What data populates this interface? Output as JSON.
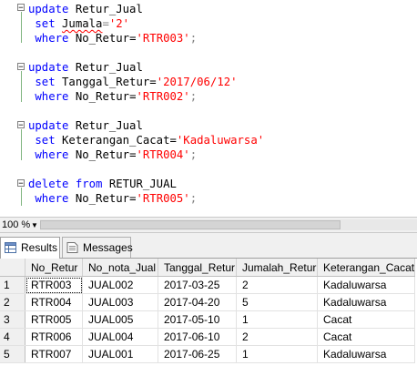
{
  "editor": {
    "blocks": [
      {
        "l1_kw": "update",
        "l1_rest": " Retur_Jual",
        "l2_kw": "set",
        "l2_a": " ",
        "l2_squig": "Jumala",
        "l2_eq": "=",
        "l2_str": "'2'",
        "l3_kw": "where",
        "l3_a": " No_Retur=",
        "l3_str": "'RTR003'",
        "l3_end": ";"
      },
      {
        "l1_kw": "update",
        "l1_rest": " Retur_Jual",
        "l2_kw": "set",
        "l2_a": " Tanggal_Retur=",
        "l2_str": "'2017/06/12'",
        "l3_kw": "where",
        "l3_a": " No_Retur=",
        "l3_str": "'RTR002'",
        "l3_end": ";"
      },
      {
        "l1_kw": "update",
        "l1_rest": " Retur_Jual",
        "l2_kw": "set",
        "l2_a": " Keterangan_Cacat=",
        "l2_str": "'Kadaluwarsa'",
        "l3_kw": "where",
        "l3_a": " No_Retur=",
        "l3_str": "'RTR004'",
        "l3_end": ";"
      },
      {
        "l1_kw": "delete",
        "l1_kw2": " from",
        "l1_rest": " RETUR_JUAL",
        "l2_kw": "where",
        "l2_a": " No_Retur=",
        "l2_str": "'RTR005'",
        "l2_end": ";"
      }
    ]
  },
  "zoom": {
    "label": "100 %"
  },
  "tabs": {
    "results": "Results",
    "messages": "Messages"
  },
  "grid": {
    "columns": [
      "No_Retur",
      "No_nota_Jual",
      "Tanggal_Retur",
      "Jumalah_Retur",
      "Keterangan_Cacat"
    ],
    "rows": [
      {
        "n": "1",
        "c": [
          "RTR003",
          "JUAL002",
          "2017-03-25",
          "2",
          "Kadaluwarsa"
        ]
      },
      {
        "n": "2",
        "c": [
          "RTR004",
          "JUAL003",
          "2017-04-20",
          "5",
          "Kadaluwarsa"
        ]
      },
      {
        "n": "3",
        "c": [
          "RTR005",
          "JUAL005",
          "2017-05-10",
          "1",
          "Cacat"
        ]
      },
      {
        "n": "4",
        "c": [
          "RTR006",
          "JUAL004",
          "2017-06-10",
          "2",
          "Cacat"
        ]
      },
      {
        "n": "5",
        "c": [
          "RTR007",
          "JUAL001",
          "2017-06-25",
          "1",
          "Kadaluwarsa"
        ]
      }
    ]
  }
}
